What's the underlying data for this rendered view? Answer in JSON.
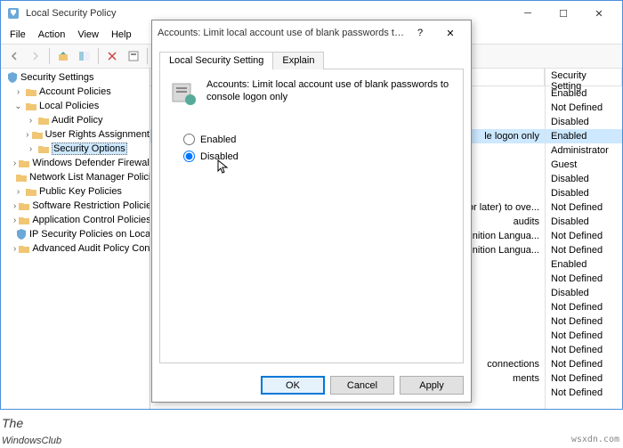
{
  "window": {
    "title": "Local Security Policy",
    "menu": [
      "File",
      "Action",
      "View",
      "Help"
    ]
  },
  "tree": {
    "root": "Security Settings",
    "items": [
      {
        "label": "Account Policies",
        "depth": 1,
        "exp": "›"
      },
      {
        "label": "Local Policies",
        "depth": 1,
        "exp": "⌄"
      },
      {
        "label": "Audit Policy",
        "depth": 2,
        "exp": "›"
      },
      {
        "label": "User Rights Assignment",
        "depth": 2,
        "exp": "›"
      },
      {
        "label": "Security Options",
        "depth": 2,
        "exp": "›",
        "selected": true
      },
      {
        "label": "Windows Defender Firewall",
        "depth": 1,
        "exp": "›"
      },
      {
        "label": "Network List Manager Policies",
        "depth": 1,
        "exp": ""
      },
      {
        "label": "Public Key Policies",
        "depth": 1,
        "exp": "›"
      },
      {
        "label": "Software Restriction Policies",
        "depth": 1,
        "exp": "›"
      },
      {
        "label": "Application Control Policies",
        "depth": 1,
        "exp": "›"
      },
      {
        "label": "IP Security Policies on Local",
        "depth": 1,
        "exp": "",
        "shield": true
      },
      {
        "label": "Advanced Audit Policy Configuration",
        "depth": 1,
        "exp": "›"
      }
    ]
  },
  "list": {
    "header": "Security Setting",
    "rows": [
      {
        "tail": "",
        "value": "Enabled"
      },
      {
        "tail": "",
        "value": "Not Defined"
      },
      {
        "tail": "",
        "value": "Disabled"
      },
      {
        "tail": "le logon only",
        "value": "Enabled",
        "selected": true
      },
      {
        "tail": "",
        "value": "Administrator"
      },
      {
        "tail": "",
        "value": "Guest"
      },
      {
        "tail": "",
        "value": "Disabled"
      },
      {
        "tail": "",
        "value": "Disabled"
      },
      {
        "tail": "or later) to ove...",
        "value": "Not Defined"
      },
      {
        "tail": "audits",
        "value": "Disabled"
      },
      {
        "tail": "nition Langua...",
        "value": "Not Defined"
      },
      {
        "tail": "nition Langua...",
        "value": "Not Defined"
      },
      {
        "tail": "",
        "value": "Enabled"
      },
      {
        "tail": "",
        "value": "Not Defined"
      },
      {
        "tail": "",
        "value": "Disabled"
      },
      {
        "tail": "",
        "value": "Not Defined"
      },
      {
        "tail": "",
        "value": "Not Defined"
      },
      {
        "tail": "",
        "value": "Not Defined"
      },
      {
        "tail": "",
        "value": "Not Defined"
      },
      {
        "tail": "connections",
        "value": "Not Defined"
      },
      {
        "tail": "ments",
        "value": "Not Defined"
      },
      {
        "tail": "",
        "value": "Not Defined"
      }
    ]
  },
  "dialog": {
    "title": "Accounts: Limit local account use of blank passwords to c...",
    "tabs": {
      "setting": "Local Security Setting",
      "explain": "Explain"
    },
    "policy_text": "Accounts: Limit local account use of blank passwords to console logon only",
    "options": {
      "enabled": "Enabled",
      "disabled": "Disabled"
    },
    "buttons": {
      "ok": "OK",
      "cancel": "Cancel",
      "apply": "Apply"
    }
  },
  "watermark": {
    "the": "The",
    "brand": "WindowsClub",
    "wsxdn": "wsxdn.com"
  }
}
